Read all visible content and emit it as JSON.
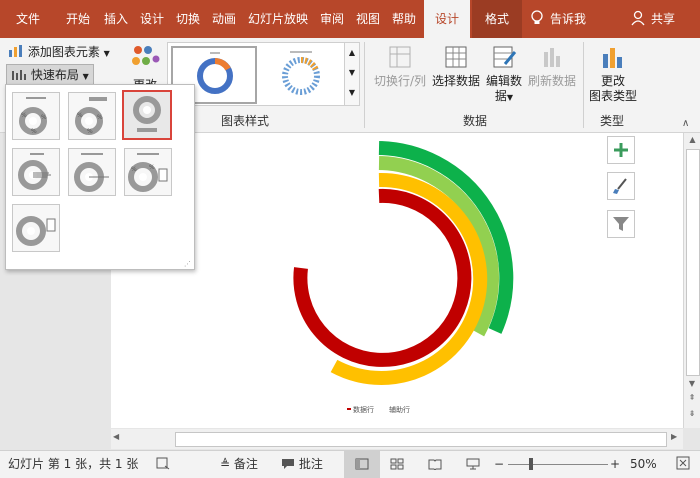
{
  "tabs": [
    {
      "label": "文件"
    },
    {
      "label": "开始"
    },
    {
      "label": "插入"
    },
    {
      "label": "设计"
    },
    {
      "label": "切换"
    },
    {
      "label": "动画"
    },
    {
      "label": "幻灯片放映"
    },
    {
      "label": "审阅"
    },
    {
      "label": "视图"
    },
    {
      "label": "帮助"
    },
    {
      "label": "设计"
    },
    {
      "label": "格式"
    }
  ],
  "tellme": "告诉我",
  "share": "共享",
  "ribbon": {
    "add_element": "添加图表元素",
    "quick_layout": "快速布局",
    "change_colors": "更改",
    "chart_styles_label": "图表样式",
    "switch_row_col": "切换行/列",
    "select_data": "选择数据",
    "edit_data_1": "编辑数",
    "edit_data_2": "据",
    "refresh_data": "刷新数据",
    "data_label": "数据",
    "change_type_1": "更改",
    "change_type_2": "图表类型",
    "type_label": "类型"
  },
  "chart": {
    "legend": [
      "数据行",
      "辅助行"
    ],
    "colors": {
      "green": "#0db14b",
      "lightgreen": "#92d050",
      "yellow": "#ffc000",
      "red": "#c00000"
    }
  },
  "status": {
    "slide_info": "幻灯片 第 1 张，共 1 张",
    "notes": "备注",
    "comments": "批注",
    "zoom": "50%"
  },
  "colors": {
    "accent": "#b7472a",
    "selected_border": "#d9443b"
  }
}
